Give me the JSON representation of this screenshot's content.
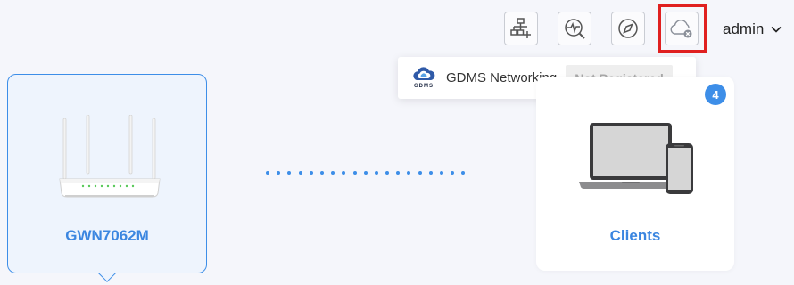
{
  "toolbar": {
    "buttons": [
      {
        "icon": "topology-add-icon"
      },
      {
        "icon": "diagnostics-icon"
      },
      {
        "icon": "compass-icon"
      },
      {
        "icon": "cloud-disconnected-icon"
      }
    ],
    "highlight_color": "#e02020"
  },
  "user_menu": {
    "username": "admin",
    "icon": "chevron-down-icon"
  },
  "cloud_popover": {
    "logo_text": "GDMS",
    "label": "GDMS Networking",
    "status": "Not Registered"
  },
  "topology": {
    "device": {
      "name": "GWN7062M",
      "icon": "router-icon"
    },
    "clients": {
      "label": "Clients",
      "count": "4",
      "icon": "laptop-phone-icon"
    }
  },
  "colors": {
    "accent": "#3d8ee8",
    "background": "#f5f6fb",
    "status_bg": "#eeeeee",
    "status_text": "#a8a8a8"
  }
}
